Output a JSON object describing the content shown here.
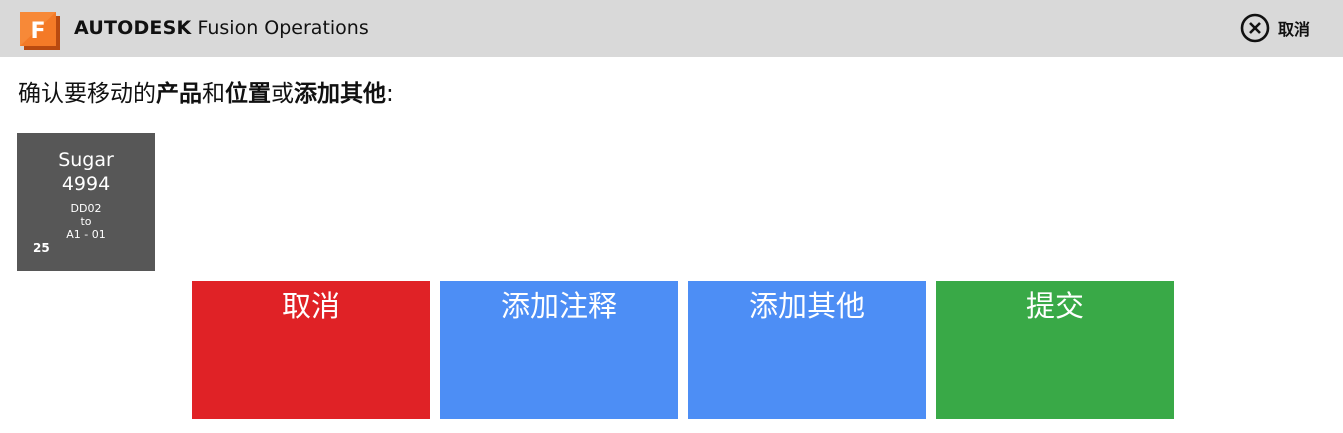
{
  "header": {
    "logo_letter": "F",
    "brand_bold": "AUTODESK",
    "brand_rest": "Fusion Operations",
    "cancel_label": "取消",
    "background": "#d9d9d9",
    "logo_color": "#f26b1d"
  },
  "prompt": {
    "part1": "确认要移动的",
    "bold1": "产品",
    "part2": "和",
    "bold2": "位置",
    "part3": "或",
    "bold3": "添加其他",
    "end": ":"
  },
  "tile": {
    "product": "Sugar",
    "id": "4994",
    "from": "DD02",
    "to_word": "to",
    "to": "A1 - 01",
    "quantity": "25",
    "color": "#575757"
  },
  "actions": [
    {
      "label": "取消",
      "color": "#e02226"
    },
    {
      "label": "添加注释",
      "color": "#4d8ef5"
    },
    {
      "label": "添加其他",
      "color": "#4d8ef5"
    },
    {
      "label": "提交",
      "color": "#39a947"
    }
  ]
}
